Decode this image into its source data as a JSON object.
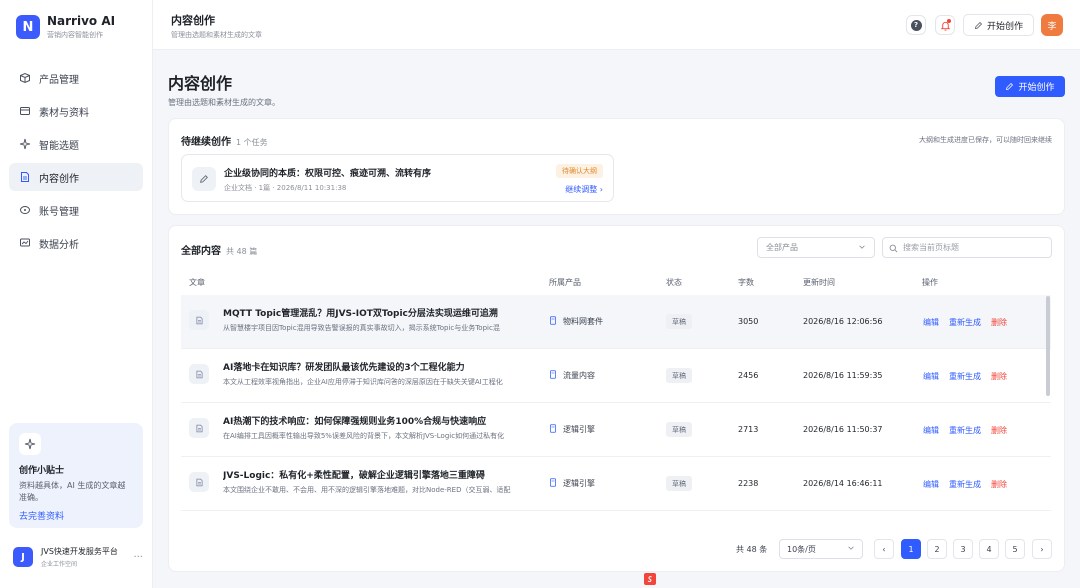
{
  "brand": {
    "name": "Narrivo AI",
    "sub": "营销内容智能创作",
    "logo_letter": "N",
    "accent": "#3b5bfd"
  },
  "nav": {
    "items": [
      {
        "label": "产品管理",
        "icon": "box-icon",
        "active": false
      },
      {
        "label": "素材与资料",
        "icon": "folder-icon",
        "active": false
      },
      {
        "label": "智能选题",
        "icon": "sparkle-icon",
        "active": false
      },
      {
        "label": "内容创作",
        "icon": "document-icon",
        "active": true
      },
      {
        "label": "账号管理",
        "icon": "account-icon",
        "active": false
      },
      {
        "label": "数据分析",
        "icon": "chart-icon",
        "active": false
      }
    ]
  },
  "tip": {
    "title": "创作小贴士",
    "text": "资料越具体，AI 生成的文章越准确。",
    "link": "去完善资料"
  },
  "account": {
    "name": "JVS快速开发服务平台",
    "sub": "企业工作空间",
    "letter": "J"
  },
  "topbar": {
    "title": "内容创作",
    "sub": "管理由选题和素材生成的文章",
    "start_label": "开始创作",
    "avatar_letter": "李"
  },
  "page": {
    "title": "内容创作",
    "sub": "管理由选题和素材生成的文章。",
    "primary_label": "开始创作"
  },
  "pending": {
    "title": "待继续创作",
    "count": "1 个任务",
    "note": "大纲和生成进度已保存，可以随时回来继续",
    "task": {
      "title": "企业级协同的本质：权限可控、痕迹可溯、流转有序",
      "meta": "企业文档 · 1篇 · 2026/8/11 10:31:38",
      "badge": "待确认大纲",
      "link": "继续调整"
    }
  },
  "all": {
    "title": "全部内容",
    "count": "共 48 篇",
    "product_filter": "全部产品",
    "search_placeholder": "搜索当前页标题",
    "headers": {
      "article": "文章",
      "product": "所属产品",
      "status": "状态",
      "words": "字数",
      "updated": "更新时间",
      "ops": "操作"
    },
    "rows": [
      {
        "title": "MQTT Topic管理混乱？用JVS-IOT双Topic分层法实现运维可追溯",
        "desc": "从智慧楼宇项目因Topic混用导致告警误报的真实事故切入，揭示系统Topic与业务Topic混",
        "product": "物料网套件",
        "status": "草稿",
        "words": "3050",
        "updated": "2026/8/16 12:06:56",
        "edit": "编辑",
        "regen": "重新生成",
        "del": "删除"
      },
      {
        "title": "AI落地卡在知识库？研发团队最该优先建设的3个工程化能力",
        "desc": "本文从工程效率视角指出，企业AI应用停滞于知识库问答的深层原因在于缺失关键AI工程化",
        "product": "流量内容",
        "status": "草稿",
        "words": "2456",
        "updated": "2026/8/16 11:59:35",
        "edit": "编辑",
        "regen": "重新生成",
        "del": "删除"
      },
      {
        "title": "AI热潮下的技术响应：如何保障强规则业务100%合规与快速响应",
        "desc": "在AI编排工具因概率性输出导致5%误差风险的背景下，本文解析JVS-Logic如何通过私有化",
        "product": "逻辑引擎",
        "status": "草稿",
        "words": "2713",
        "updated": "2026/8/16 11:50:37",
        "edit": "编辑",
        "regen": "重新生成",
        "del": "删除"
      },
      {
        "title": "JVS-Logic：私有化+柔性配置，破解企业逻辑引擎落地三重障碍",
        "desc": "本文围绕企业不敢用、不会用、用不深的逻辑引擎落地难题，对比Node-RED（交互弱、适配",
        "product": "逻辑引擎",
        "status": "草稿",
        "words": "2238",
        "updated": "2026/8/14 16:46:11",
        "edit": "编辑",
        "regen": "重新生成",
        "del": "删除"
      }
    ]
  },
  "pager": {
    "total": "共 48 条",
    "size": "10条/页",
    "pages": [
      "1",
      "2",
      "3",
      "4",
      "5"
    ],
    "prev": "‹",
    "next": "›"
  }
}
